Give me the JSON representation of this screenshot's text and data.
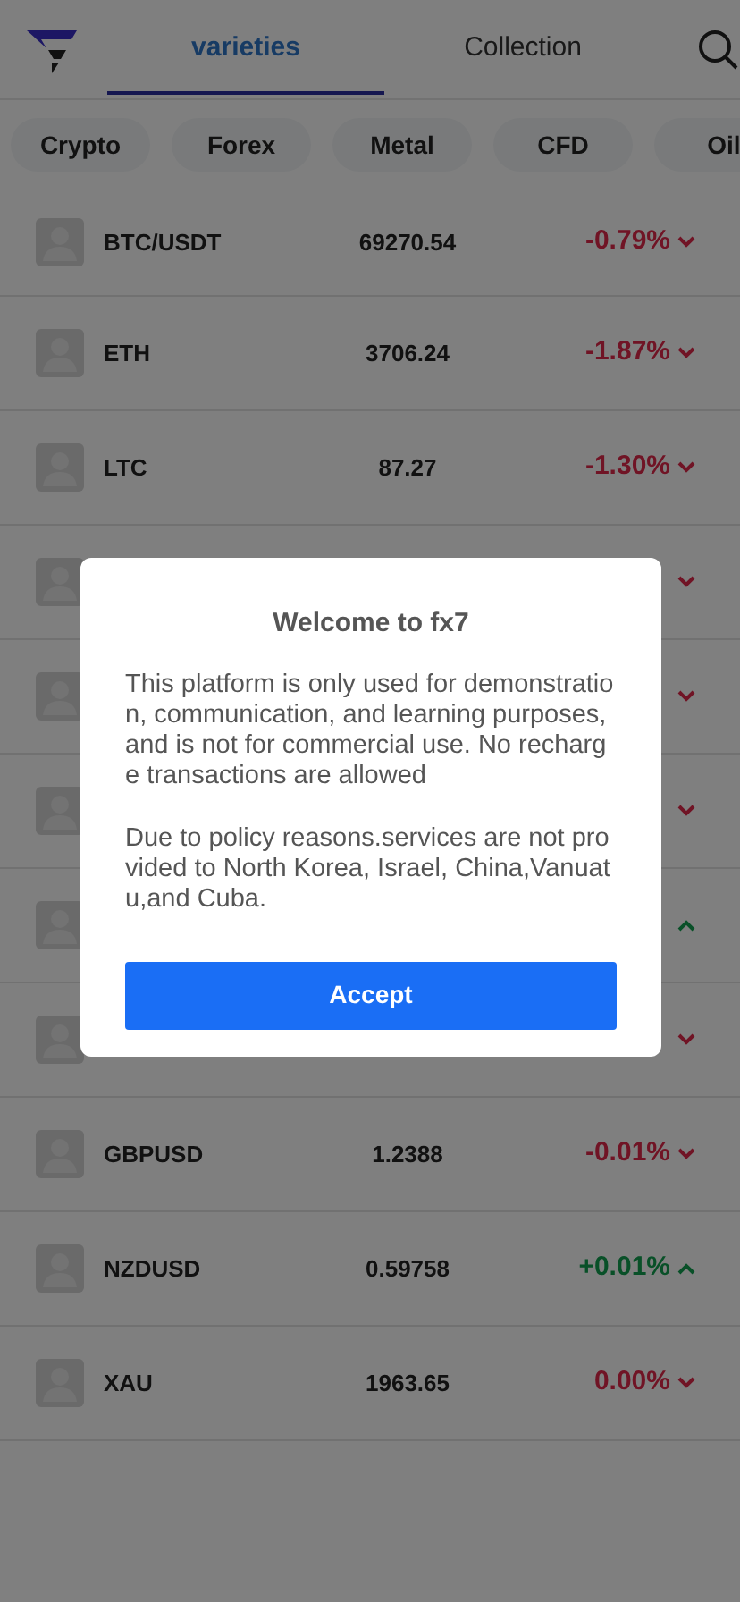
{
  "header": {
    "tabs": [
      {
        "label": "varieties",
        "selected": true
      },
      {
        "label": "Collection",
        "selected": false
      }
    ]
  },
  "categories": [
    {
      "label": "Crypto"
    },
    {
      "label": "Forex"
    },
    {
      "label": "Metal"
    },
    {
      "label": "CFD"
    },
    {
      "label": "Oil"
    }
  ],
  "rows": [
    {
      "kind": "full",
      "symbol": "BTC/USDT",
      "price": "69270.54",
      "change": "-0.79%",
      "up": false
    },
    {
      "kind": "full",
      "symbol": "ETH",
      "price": "3706.24",
      "change": "-1.87%",
      "up": false
    },
    {
      "kind": "full",
      "symbol": "LTC",
      "price": "87.27",
      "change": "-1.30%",
      "up": false
    },
    {
      "kind": "covered",
      "up": false
    },
    {
      "kind": "covered",
      "up": false
    },
    {
      "kind": "covered",
      "up": false
    },
    {
      "kind": "covered",
      "up": true
    },
    {
      "kind": "covered",
      "up": false
    },
    {
      "kind": "full",
      "symbol": "GBPUSD",
      "price": "1.2388",
      "change": "-0.01%",
      "up": false
    },
    {
      "kind": "full",
      "symbol": "NZDUSD",
      "price": "0.59758",
      "change": "+0.01%",
      "up": true
    },
    {
      "kind": "full",
      "symbol": "XAU",
      "price": "1963.65",
      "change": "0.00%",
      "up": false
    }
  ],
  "dialog": {
    "title": "Welcome to fx7",
    "paragraphs": [
      "This platform is only used for demonstration, communication, and learning purposes, and is not for commercial use. No recharge transactions are allowed",
      "Due to policy reasons.services are not provided to North Korea, Israel, China,Vanuatu,and Cuba."
    ],
    "button": "Accept"
  }
}
